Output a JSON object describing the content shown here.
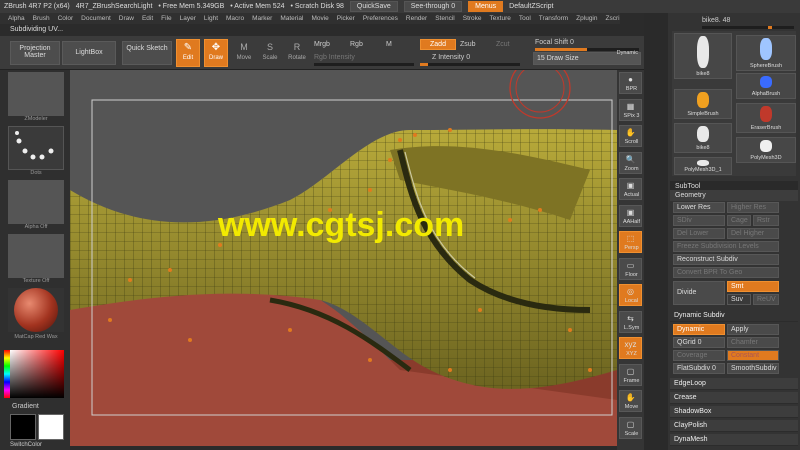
{
  "titlebar": {
    "app": "ZBrush 4R7 P2 (x64)",
    "project": "4R7_ZBrushSearchLight",
    "free_mem": "• Free Mem 5.349GB",
    "active_mem": "• Active Mem 524",
    "scratch": "• Scratch Disk 98",
    "quicksave": "QuickSave",
    "seethrough": "See-through 0",
    "menus": "Menus",
    "script": "DefaultZScript"
  },
  "menubar": {
    "items": [
      "Alpha",
      "Brush",
      "Color",
      "Document",
      "Draw",
      "Edit",
      "File",
      "Layer",
      "Light",
      "Macro",
      "Marker",
      "Material",
      "Movie",
      "Picker",
      "Preferences",
      "Render",
      "Stencil",
      "Stroke",
      "Texture",
      "Tool",
      "Transform",
      "Zplugin",
      "Zscript"
    ]
  },
  "status": "Subdividing UV...",
  "shelf": {
    "projection_master": "Projection Master",
    "lightbox": "LightBox",
    "quick_sketch": "Quick Sketch",
    "edit": "Edit",
    "draw": "Draw",
    "move": "Move",
    "scale": "Scale",
    "rotate": "Rotate",
    "mrgb": "Mrgb",
    "rgb": "Rgb",
    "m": "M",
    "zadd": "Zadd",
    "zsub": "Zsub",
    "zcut": "Zcut",
    "rgb_intensity": "Rgb Intensity",
    "z_intensity": "Z Intensity 0",
    "focal_shift": "Focal Shift 0",
    "draw_size": "15 Draw Size",
    "dynamic": "Dynamic"
  },
  "left": {
    "brush_tile": "ZModeler",
    "stroke_tile": "Dots",
    "alpha_tile": "Alpha Off",
    "texture_tile": "Texture Off",
    "material_tile": "MatCap Red Wax",
    "gradient": "Gradient",
    "switchcolor": "SwitchColor"
  },
  "viewport": {
    "watermark": "www.cgtsj.com"
  },
  "righttools": {
    "items": [
      "BPR",
      "SPix 3",
      "Scroll",
      "Zoom",
      "Actual",
      "AAHalf",
      "Persp",
      "Floor",
      "Local",
      "L.Sym",
      "XYZ",
      "Frame",
      "Move",
      "Scale"
    ]
  },
  "tool": {
    "current": "bike8. 48",
    "tiles": [
      "bike8",
      "SphereBrush",
      "AlphaBrush",
      "SimpleBrush",
      "EraserBrush",
      "bike8",
      "PolyMesh3D",
      "PolyMesh3D_1"
    ]
  },
  "subtool": {
    "header": "SubTool",
    "geometry": "Geometry",
    "lower_res": "Lower Res",
    "higher_res": "Higher Res",
    "sdiv": "SDiv",
    "cage": "Cage",
    "rstr": "Rstr",
    "del_lower": "Del Lower",
    "del_higher": "Del Higher",
    "freeze": "Freeze Subdivision Levels",
    "reconstruct": "Reconstruct Subdiv",
    "convert_bpr": "Convert BPR To Geo",
    "divide": "Divide",
    "smt": "Smt",
    "suv": "Suv",
    "reuv": "ReUV",
    "dynamic_subdiv": "Dynamic Subdiv",
    "dynamic": "Dynamic",
    "apply": "Apply",
    "qgrid": "QGrid 0",
    "chamfer": "Chamfer",
    "coverage": "Coverage",
    "constant": "Constant",
    "flatsubdiv": "FlatSubdiv 0",
    "smoothsubdiv": "SmoothSubdiv",
    "edgeloop": "EdgeLoop",
    "crease": "Crease",
    "shadowbox": "ShadowBox",
    "claypolish": "ClayPolish",
    "dynamesh": "DynaMesh"
  }
}
